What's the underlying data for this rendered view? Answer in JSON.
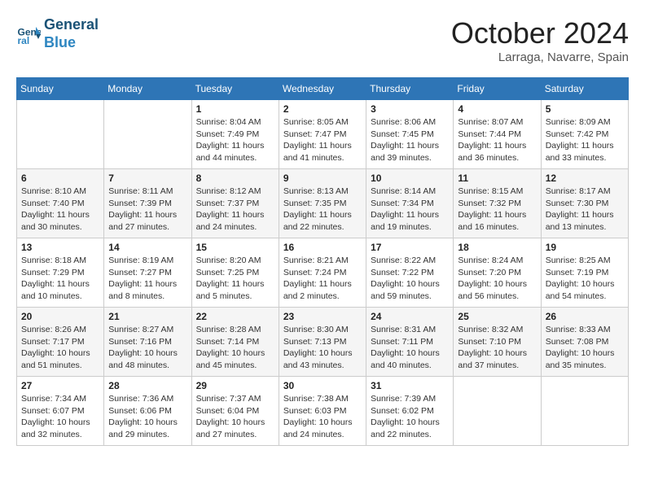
{
  "header": {
    "logo_line1": "General",
    "logo_line2": "Blue",
    "month": "October 2024",
    "location": "Larraga, Navarre, Spain"
  },
  "days_of_week": [
    "Sunday",
    "Monday",
    "Tuesday",
    "Wednesday",
    "Thursday",
    "Friday",
    "Saturday"
  ],
  "weeks": [
    [
      {
        "day": "",
        "content": ""
      },
      {
        "day": "",
        "content": ""
      },
      {
        "day": "1",
        "content": "Sunrise: 8:04 AM\nSunset: 7:49 PM\nDaylight: 11 hours and 44 minutes."
      },
      {
        "day": "2",
        "content": "Sunrise: 8:05 AM\nSunset: 7:47 PM\nDaylight: 11 hours and 41 minutes."
      },
      {
        "day": "3",
        "content": "Sunrise: 8:06 AM\nSunset: 7:45 PM\nDaylight: 11 hours and 39 minutes."
      },
      {
        "day": "4",
        "content": "Sunrise: 8:07 AM\nSunset: 7:44 PM\nDaylight: 11 hours and 36 minutes."
      },
      {
        "day": "5",
        "content": "Sunrise: 8:09 AM\nSunset: 7:42 PM\nDaylight: 11 hours and 33 minutes."
      }
    ],
    [
      {
        "day": "6",
        "content": "Sunrise: 8:10 AM\nSunset: 7:40 PM\nDaylight: 11 hours and 30 minutes."
      },
      {
        "day": "7",
        "content": "Sunrise: 8:11 AM\nSunset: 7:39 PM\nDaylight: 11 hours and 27 minutes."
      },
      {
        "day": "8",
        "content": "Sunrise: 8:12 AM\nSunset: 7:37 PM\nDaylight: 11 hours and 24 minutes."
      },
      {
        "day": "9",
        "content": "Sunrise: 8:13 AM\nSunset: 7:35 PM\nDaylight: 11 hours and 22 minutes."
      },
      {
        "day": "10",
        "content": "Sunrise: 8:14 AM\nSunset: 7:34 PM\nDaylight: 11 hours and 19 minutes."
      },
      {
        "day": "11",
        "content": "Sunrise: 8:15 AM\nSunset: 7:32 PM\nDaylight: 11 hours and 16 minutes."
      },
      {
        "day": "12",
        "content": "Sunrise: 8:17 AM\nSunset: 7:30 PM\nDaylight: 11 hours and 13 minutes."
      }
    ],
    [
      {
        "day": "13",
        "content": "Sunrise: 8:18 AM\nSunset: 7:29 PM\nDaylight: 11 hours and 10 minutes."
      },
      {
        "day": "14",
        "content": "Sunrise: 8:19 AM\nSunset: 7:27 PM\nDaylight: 11 hours and 8 minutes."
      },
      {
        "day": "15",
        "content": "Sunrise: 8:20 AM\nSunset: 7:25 PM\nDaylight: 11 hours and 5 minutes."
      },
      {
        "day": "16",
        "content": "Sunrise: 8:21 AM\nSunset: 7:24 PM\nDaylight: 11 hours and 2 minutes."
      },
      {
        "day": "17",
        "content": "Sunrise: 8:22 AM\nSunset: 7:22 PM\nDaylight: 10 hours and 59 minutes."
      },
      {
        "day": "18",
        "content": "Sunrise: 8:24 AM\nSunset: 7:20 PM\nDaylight: 10 hours and 56 minutes."
      },
      {
        "day": "19",
        "content": "Sunrise: 8:25 AM\nSunset: 7:19 PM\nDaylight: 10 hours and 54 minutes."
      }
    ],
    [
      {
        "day": "20",
        "content": "Sunrise: 8:26 AM\nSunset: 7:17 PM\nDaylight: 10 hours and 51 minutes."
      },
      {
        "day": "21",
        "content": "Sunrise: 8:27 AM\nSunset: 7:16 PM\nDaylight: 10 hours and 48 minutes."
      },
      {
        "day": "22",
        "content": "Sunrise: 8:28 AM\nSunset: 7:14 PM\nDaylight: 10 hours and 45 minutes."
      },
      {
        "day": "23",
        "content": "Sunrise: 8:30 AM\nSunset: 7:13 PM\nDaylight: 10 hours and 43 minutes."
      },
      {
        "day": "24",
        "content": "Sunrise: 8:31 AM\nSunset: 7:11 PM\nDaylight: 10 hours and 40 minutes."
      },
      {
        "day": "25",
        "content": "Sunrise: 8:32 AM\nSunset: 7:10 PM\nDaylight: 10 hours and 37 minutes."
      },
      {
        "day": "26",
        "content": "Sunrise: 8:33 AM\nSunset: 7:08 PM\nDaylight: 10 hours and 35 minutes."
      }
    ],
    [
      {
        "day": "27",
        "content": "Sunrise: 7:34 AM\nSunset: 6:07 PM\nDaylight: 10 hours and 32 minutes."
      },
      {
        "day": "28",
        "content": "Sunrise: 7:36 AM\nSunset: 6:06 PM\nDaylight: 10 hours and 29 minutes."
      },
      {
        "day": "29",
        "content": "Sunrise: 7:37 AM\nSunset: 6:04 PM\nDaylight: 10 hours and 27 minutes."
      },
      {
        "day": "30",
        "content": "Sunrise: 7:38 AM\nSunset: 6:03 PM\nDaylight: 10 hours and 24 minutes."
      },
      {
        "day": "31",
        "content": "Sunrise: 7:39 AM\nSunset: 6:02 PM\nDaylight: 10 hours and 22 minutes."
      },
      {
        "day": "",
        "content": ""
      },
      {
        "day": "",
        "content": ""
      }
    ]
  ]
}
